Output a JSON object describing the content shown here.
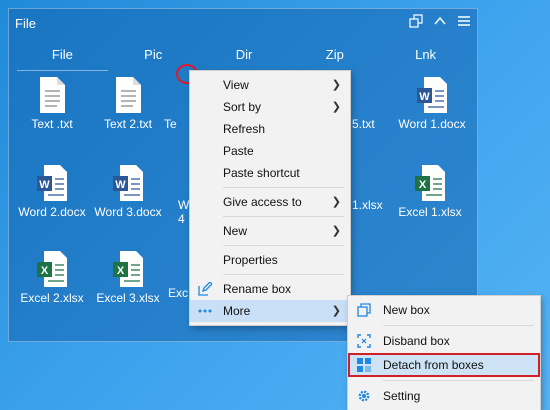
{
  "box": {
    "title": "File",
    "tabs": [
      "File",
      "Pic",
      "Dir",
      "Zip",
      "Lnk"
    ]
  },
  "files": [
    {
      "name": "Text .txt",
      "type": "txt"
    },
    {
      "name": "Text 2.txt",
      "type": "txt"
    },
    {
      "name": "Te",
      "type": "txt"
    },
    {
      "name": "5.txt",
      "type": "txt"
    },
    {
      "name": "Word 1.docx",
      "type": "docx"
    },
    {
      "name": "Word 2.docx",
      "type": "docx"
    },
    {
      "name": "Word 3.docx",
      "type": "docx"
    },
    {
      "name": "W 4",
      "type": "docx"
    },
    {
      "name": "1.xlsx",
      "type": "xlsx"
    },
    {
      "name": "Excel 1.xlsx",
      "type": "xlsx"
    },
    {
      "name": "Excel 2.xlsx",
      "type": "xlsx"
    },
    {
      "name": "Excel 3.xlsx",
      "type": "xlsx"
    },
    {
      "name": "Exc",
      "type": "xlsx"
    }
  ],
  "menu": {
    "view": "View",
    "sort_by": "Sort by",
    "refresh": "Refresh",
    "paste": "Paste",
    "paste_shortcut": "Paste shortcut",
    "give_access": "Give access to",
    "new": "New",
    "properties": "Properties",
    "rename_box": "Rename box",
    "more": "More"
  },
  "submenu": {
    "new_box": "New box",
    "disband_box": "Disband box",
    "detach": "Detach from boxes",
    "setting": "Setting"
  },
  "colors": {
    "accent": "#1e88e5",
    "highlight_outline": "#d0212b",
    "word_blue": "#2b5797",
    "excel_green": "#1f7244"
  }
}
